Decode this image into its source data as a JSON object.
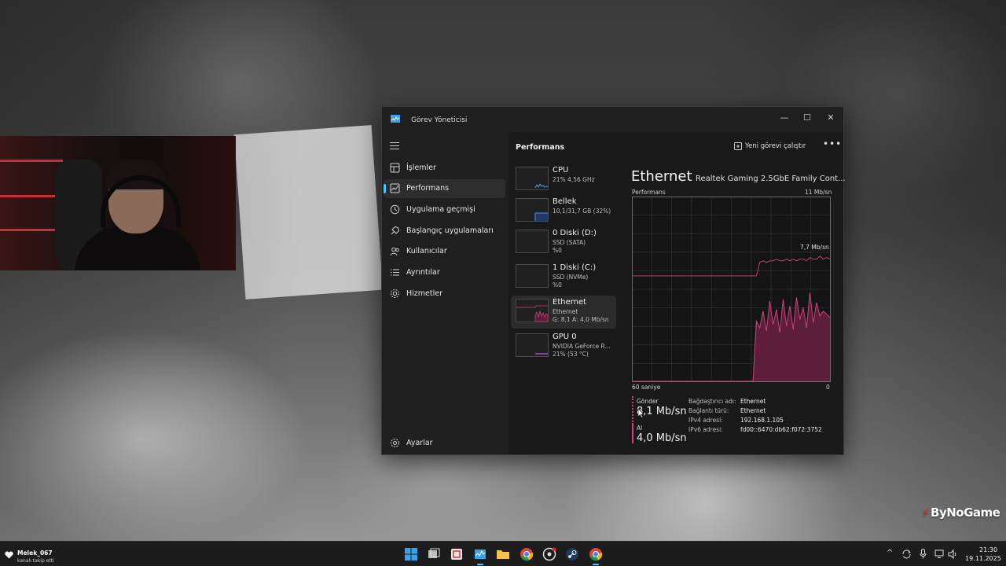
{
  "window": {
    "title": "Görev Yöneticisi",
    "min": "—",
    "max": "☐",
    "close": "✕"
  },
  "nav": {
    "items": [
      {
        "label": "İşlemler",
        "icon": "processes-icon"
      },
      {
        "label": "Performans",
        "icon": "performance-icon",
        "active": true
      },
      {
        "label": "Uygulama geçmişi",
        "icon": "app-history-icon"
      },
      {
        "label": "Başlangıç uygulamaları",
        "icon": "startup-icon"
      },
      {
        "label": "Kullanıcılar",
        "icon": "users-icon"
      },
      {
        "label": "Ayrıntılar",
        "icon": "details-icon"
      },
      {
        "label": "Hizmetler",
        "icon": "services-icon"
      }
    ],
    "settings": "Ayarlar"
  },
  "header": {
    "title": "Performans",
    "new_task": "Yeni görevi çalıştır",
    "more": "•••"
  },
  "devices": [
    {
      "name": "CPU",
      "line1": "21% 4,56 GHz",
      "line2": ""
    },
    {
      "name": "Bellek",
      "line1": "10,1/31,7 GB (32%)",
      "line2": ""
    },
    {
      "name": "0 Diski (D:)",
      "line1": "SSD (SATA)",
      "line2": "%0"
    },
    {
      "name": "1 Diski (C:)",
      "line1": "SSD (NVMe)",
      "line2": "%0"
    },
    {
      "name": "Ethernet",
      "line1": "Ethernet",
      "line2": "G: 8,1 A: 4,0 Mb/sn",
      "active": true
    },
    {
      "name": "GPU 0",
      "line1": "NVIDIA GeForce R...",
      "line2": "21% (53 °C)"
    }
  ],
  "detail": {
    "title": "Ethernet",
    "adapter": "Realtek Gaming 2.5GbE Family Cont...",
    "graph_label": "Performans",
    "graph_max": "11 Mb/sn",
    "axis_left": "60 saniye",
    "axis_right": "0",
    "send_label": "Gönder",
    "send_value": "8,1 Mb/sn",
    "recv_label": "Al",
    "recv_value": "4,0 Mb/sn",
    "props": [
      {
        "k": "Bağdaştırıcı adı:",
        "v": "Ethernet"
      },
      {
        "k": "Bağlantı türü:",
        "v": "Ethernet"
      },
      {
        "k": "IPv4 adresi:",
        "v": "192.168.1.105"
      },
      {
        "k": "IPv6 adresi:",
        "v": "fd00::6470:db62:f072:3752"
      }
    ]
  },
  "chart_data": {
    "type": "line",
    "x_range_seconds": [
      60,
      0
    ],
    "ylim": [
      0,
      11
    ],
    "y_unit": "Mb/sn",
    "peak_label": "7,7 Mb/sn",
    "series": [
      {
        "name": "Gönder",
        "values": [
          6.3,
          6.3,
          6.3,
          6.3,
          6.3,
          6.3,
          6.3,
          6.3,
          6.3,
          6.3,
          6.3,
          6.3,
          6.3,
          6.3,
          6.3,
          6.3,
          6.3,
          6.3,
          6.3,
          6.3,
          6.3,
          6.3,
          6.3,
          6.3,
          6.3,
          6.3,
          6.3,
          6.3,
          6.3,
          6.3,
          6.3,
          6.3,
          6.3,
          6.3,
          6.3,
          6.3,
          6.3,
          6.3,
          7.1,
          7.2,
          7.1,
          7.2,
          7.2,
          7.3,
          7.2,
          7.2,
          7.3,
          7.2,
          7.3,
          7.2,
          7.3,
          7.3,
          7.2,
          7.4,
          7.3,
          7.3,
          7.5,
          7.3,
          7.4,
          7.3
        ]
      },
      {
        "name": "Al",
        "values": [
          0,
          0,
          0,
          0,
          0,
          0,
          0,
          0,
          0,
          0,
          0,
          0,
          0,
          0,
          0,
          0,
          0,
          0,
          0,
          0,
          0,
          0,
          0,
          0,
          0,
          0,
          0,
          0,
          0,
          0,
          0,
          0,
          0,
          0,
          0,
          0,
          0,
          3.6,
          3.2,
          4.2,
          3.0,
          4.8,
          3.4,
          4.3,
          2.9,
          4.9,
          3.3,
          4.5,
          3.1,
          5.0,
          3.7,
          4.4,
          3.2,
          5.3,
          3.5,
          4.7,
          3.9,
          4.2,
          4.0,
          3.8
        ]
      }
    ]
  },
  "watermark": {
    "text": "ByNoGame"
  },
  "taskbar": {
    "notif_user": "Melek_067",
    "notif_text": "kanalı takip etti",
    "time": "21:30",
    "date": "19.11.2025",
    "chevron": "^"
  },
  "colors": {
    "accent": "#4cc2ff",
    "ethernet": "#c9447c",
    "fill": "#5c1e38",
    "send_line": "#c9447c"
  }
}
